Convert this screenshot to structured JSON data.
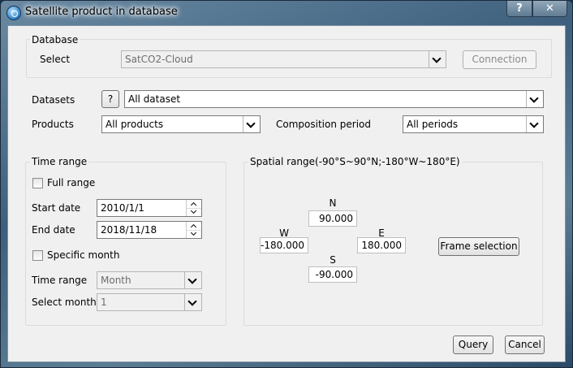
{
  "window": {
    "title": "Satellite product in database",
    "help_label": "?",
    "close_label": "✕"
  },
  "database": {
    "legend": "Database",
    "select_label": "Select",
    "select_value": "SatCO2-Cloud",
    "connection_button": "Connection"
  },
  "datasets": {
    "label": "Datasets",
    "help_label": "?",
    "value": "All dataset"
  },
  "products": {
    "label": "Products",
    "value": "All products"
  },
  "composition": {
    "label": "Composition period",
    "value": "All periods"
  },
  "time_range": {
    "legend": "Time range",
    "full_range_label": "Full range",
    "start_date_label": "Start date",
    "start_date_value": "2010/1/1",
    "end_date_label": "End date",
    "end_date_value": "2018/11/18",
    "specific_month_label": "Specific month",
    "time_range_label": "Time range",
    "time_range_value": "Month",
    "select_month_label": "Select month",
    "select_month_value": "1"
  },
  "spatial_range": {
    "legend": "Spatial range(-90°S~90°N;-180°W~180°E)",
    "n_label": "N",
    "n_value": "90.000",
    "w_label": "W",
    "w_value": "-180.000",
    "e_label": "E",
    "e_value": "180.000",
    "s_label": "S",
    "s_value": "-90.000",
    "frame_button": "Frame selection"
  },
  "footer": {
    "query_button": "Query",
    "cancel_button": "Cancel"
  }
}
